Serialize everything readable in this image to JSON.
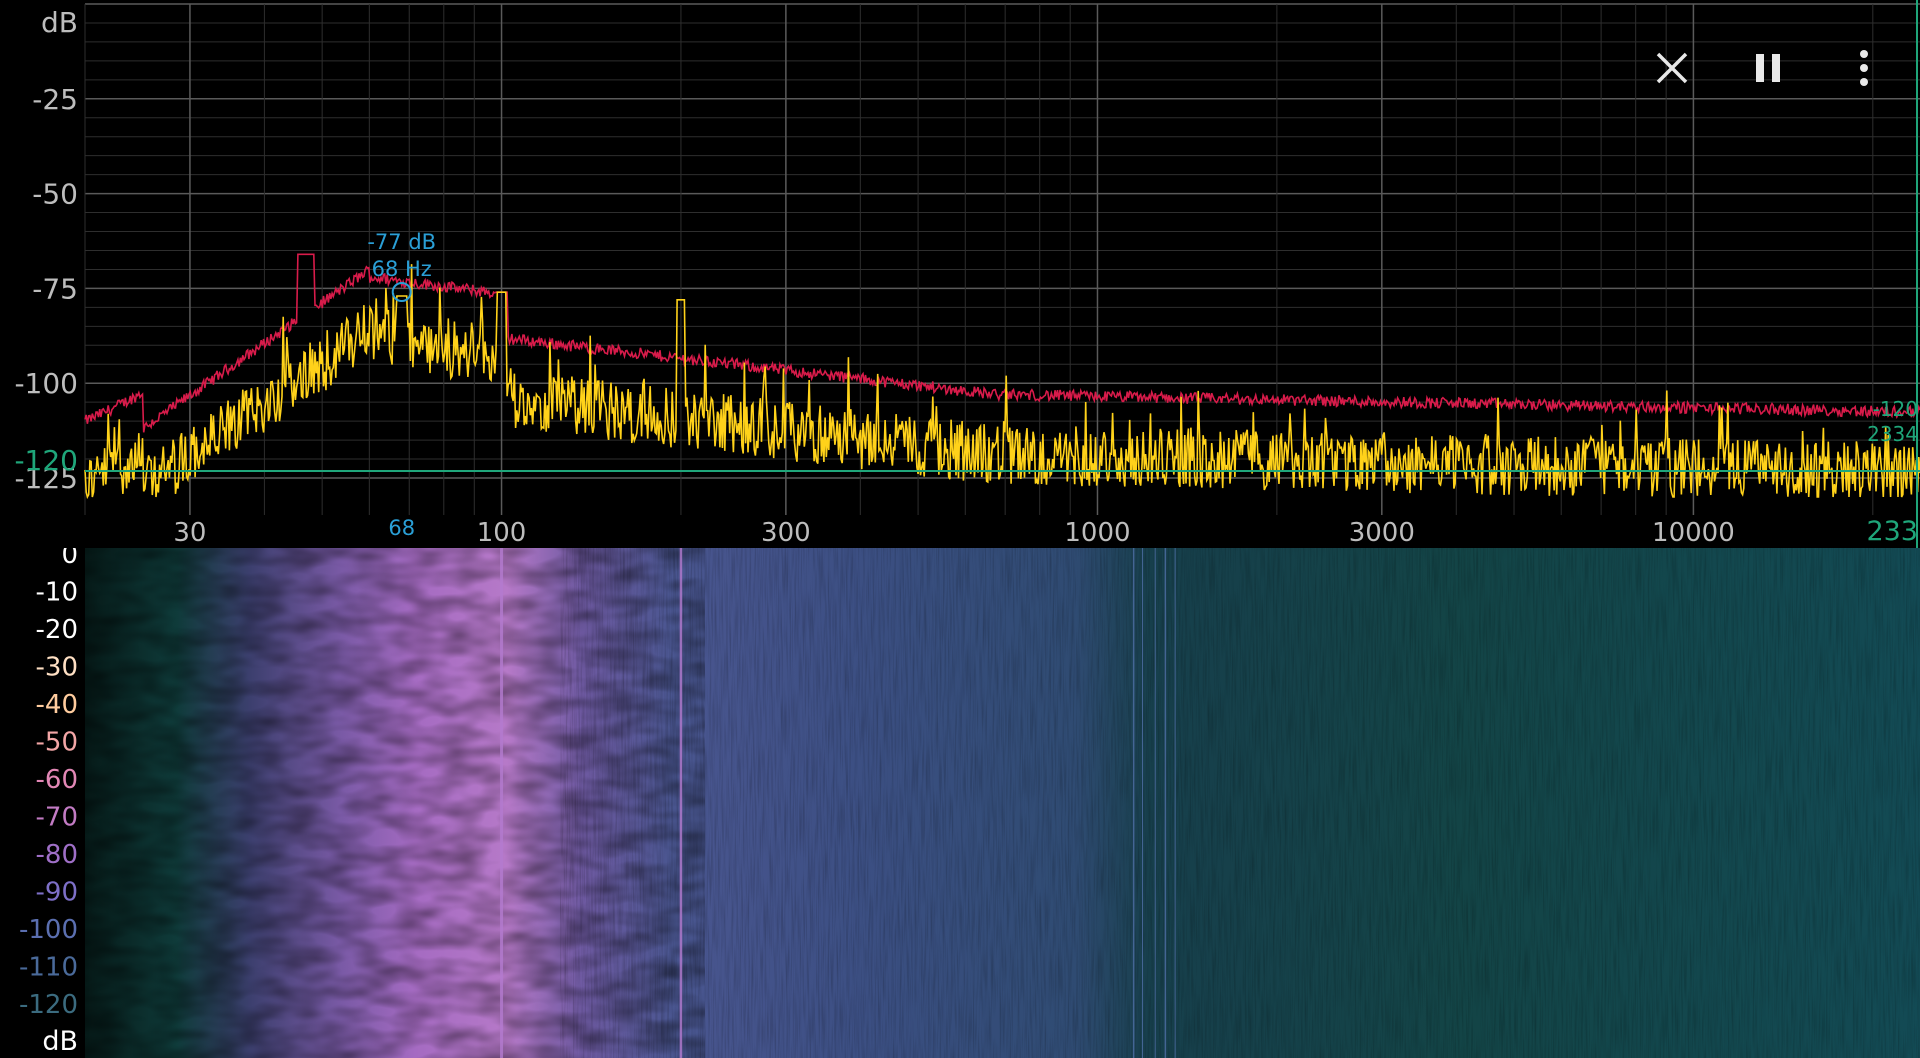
{
  "spectrum": {
    "db_unit": "dB",
    "y_ticks": [
      "-25",
      "-50",
      "-75",
      "-100",
      "-125"
    ],
    "x_ticks": [
      "30",
      "100",
      "300",
      "1000",
      "3000",
      "10000"
    ],
    "x_edge_value": "233",
    "ref_level": "-120",
    "ref_level_right": "-120",
    "ref_freq_right": "2334",
    "cursor": {
      "db_text": "-77 dB",
      "hz_text": "68 Hz",
      "axis_text": "68"
    },
    "colors": {
      "live": "#ffd21a",
      "peak": "#d81b4a",
      "ref": "#1fa67a",
      "cursor": "#2a9fd6",
      "grid": "#444"
    }
  },
  "spectrogram": {
    "scale_ticks": [
      "0",
      "-10",
      "-20",
      "-30",
      "-40",
      "-50",
      "-60",
      "-70",
      "-80",
      "-90",
      "-100",
      "-110",
      "-120"
    ],
    "scale_colors": [
      "#ffffff",
      "#ffffff",
      "#ffffff",
      "#ffe0c4",
      "#ffcc9e",
      "#f3a6a6",
      "#e287b5",
      "#c27bc4",
      "#9f6fc7",
      "#7d6fc7",
      "#5b6fb0",
      "#4a6a9a",
      "#3b6b7f"
    ],
    "db_unit": "dB"
  },
  "toolbar": {
    "close": "close-icon",
    "pause": "pause-icon",
    "more": "more-vertical-icon"
  }
}
